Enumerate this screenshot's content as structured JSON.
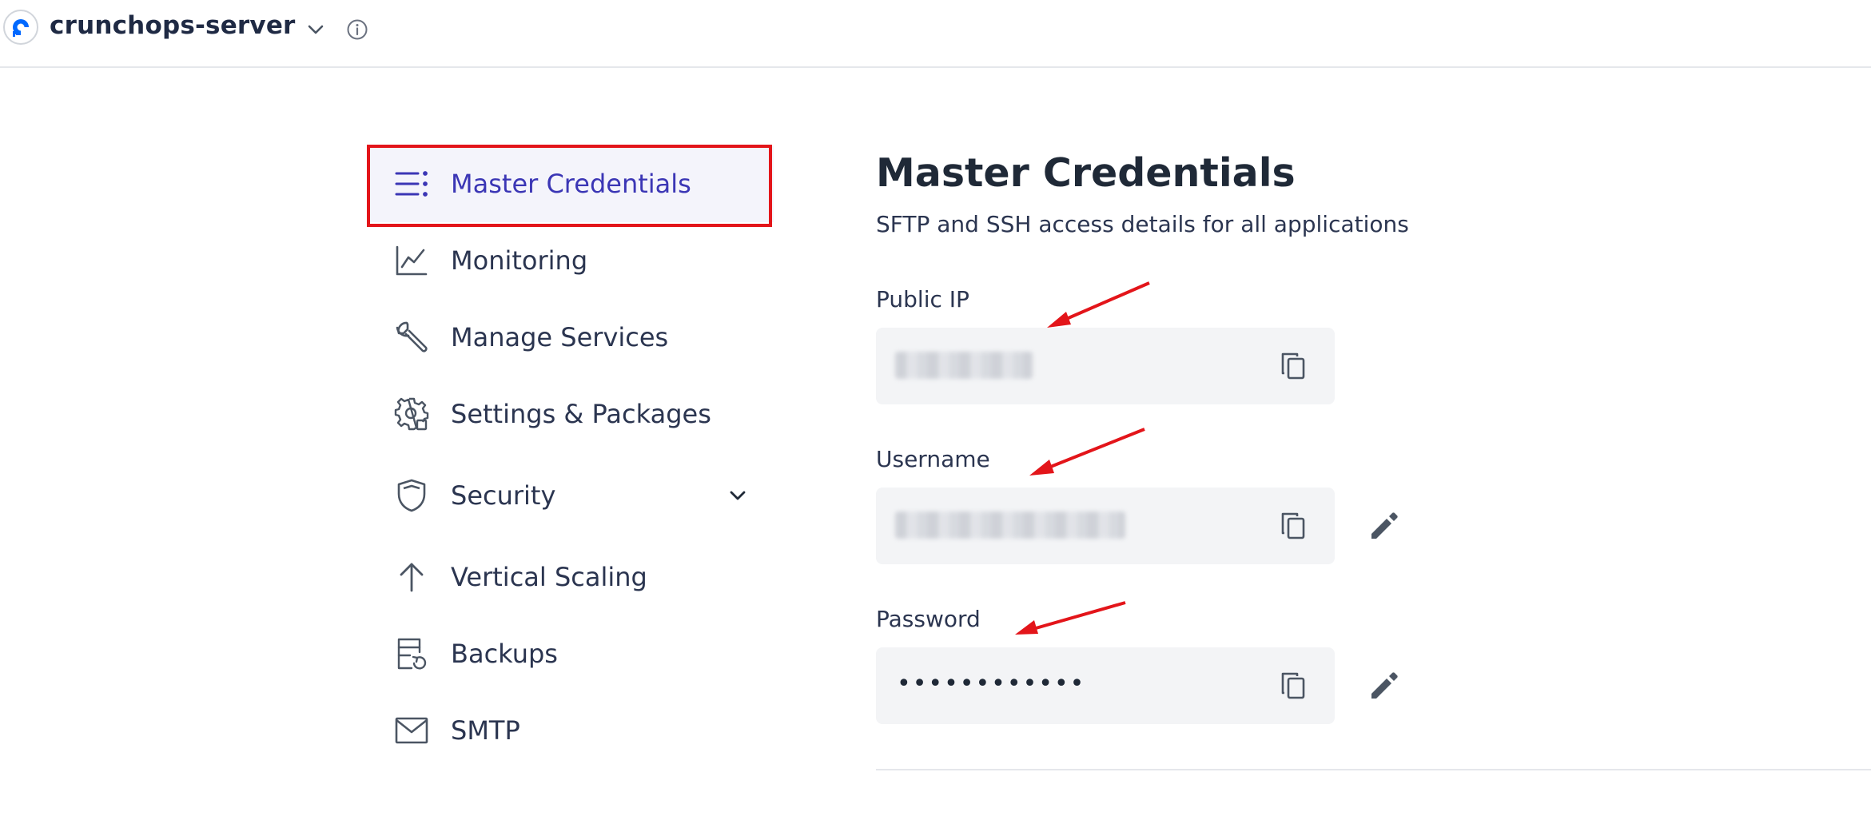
{
  "header": {
    "server_name": "crunchops-server"
  },
  "sidebar": {
    "items": [
      {
        "label": "Master Credentials",
        "icon": "list-icon",
        "active": true
      },
      {
        "label": "Monitoring",
        "icon": "chart-icon"
      },
      {
        "label": "Manage Services",
        "icon": "wrench-icon"
      },
      {
        "label": "Settings & Packages",
        "icon": "gear-icon"
      },
      {
        "label": "Security",
        "icon": "shield-icon",
        "expandable": true
      },
      {
        "label": "Vertical Scaling",
        "icon": "arrow-up-icon"
      },
      {
        "label": "Backups",
        "icon": "backup-icon"
      },
      {
        "label": "SMTP",
        "icon": "mail-icon"
      }
    ]
  },
  "main": {
    "title": "Master Credentials",
    "subtitle": "SFTP and SSH access details for all applications",
    "fields": [
      {
        "label": "Public IP",
        "value_obscured": true,
        "editable": false
      },
      {
        "label": "Username",
        "value_obscured": true,
        "editable": true
      },
      {
        "label": "Password",
        "value": "••••••••••••",
        "editable": true
      }
    ]
  },
  "colors": {
    "accent": "#3b36b5",
    "highlight": "#e3151a",
    "field_bg": "#f3f4f6",
    "text": "#2b3550"
  }
}
